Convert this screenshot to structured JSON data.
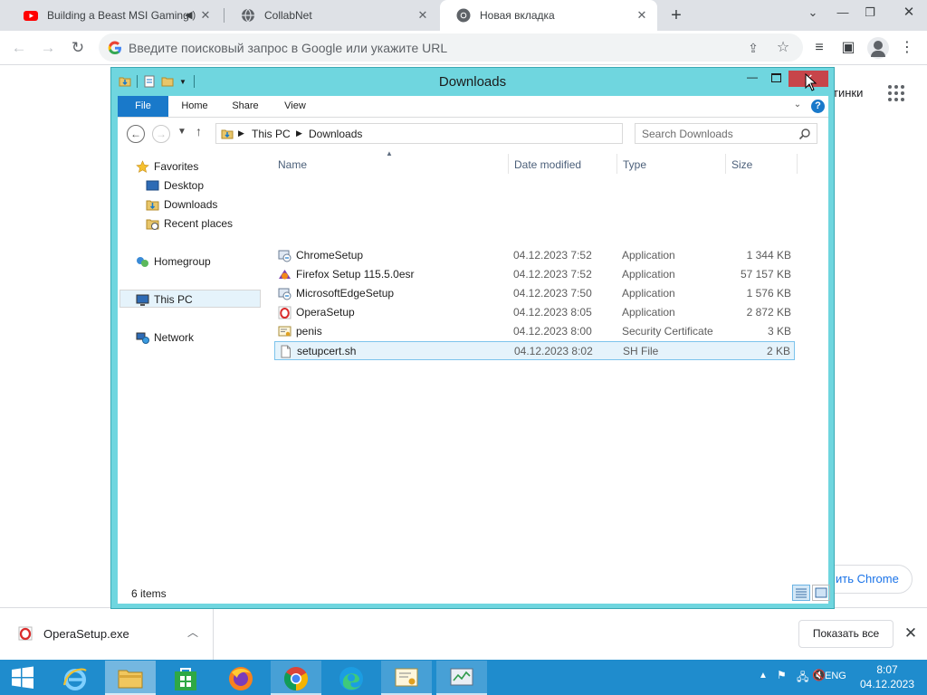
{
  "browser": {
    "tabs": [
      {
        "title": "Building a Beast MSI Gaming",
        "icon": "youtube-icon",
        "audio": true
      },
      {
        "title": "CollabNet",
        "icon": "globe-icon",
        "audio": false
      },
      {
        "title": "Новая вкладка",
        "icon": "chrome-icon",
        "audio": false,
        "active": true
      }
    ],
    "omnibox_placeholder": "Введите поисковый запрос в Google или укажите URL",
    "ntp": {
      "images_link_partial": "тинки",
      "set_chrome_partial": "ить Chrome"
    },
    "download_bar": {
      "file_name": "OperaSetup.exe",
      "show_all": "Показать все"
    }
  },
  "explorer": {
    "title": "Downloads",
    "ribbon_tabs": [
      "File",
      "Home",
      "Share",
      "View"
    ],
    "breadcrumb": [
      "This PC",
      "Downloads"
    ],
    "search_placeholder": "Search Downloads",
    "nav": {
      "favorites": "Favorites",
      "desktop": "Desktop",
      "downloads": "Downloads",
      "recent": "Recent places",
      "homegroup": "Homegroup",
      "this_pc": "This PC",
      "network": "Network"
    },
    "columns": {
      "name": "Name",
      "date": "Date modified",
      "type": "Type",
      "size": "Size"
    },
    "files": [
      {
        "name": "ChromeSetup",
        "date": "04.12.2023 7:52",
        "type": "Application",
        "size": "1 344 KB",
        "icon": "setup-app-icon"
      },
      {
        "name": "Firefox Setup 115.5.0esr",
        "date": "04.12.2023 7:52",
        "type": "Application",
        "size": "57 157 KB",
        "icon": "firefox-setup-icon"
      },
      {
        "name": "MicrosoftEdgeSetup",
        "date": "04.12.2023 7:50",
        "type": "Application",
        "size": "1 576 KB",
        "icon": "setup-app-icon"
      },
      {
        "name": "OperaSetup",
        "date": "04.12.2023 8:05",
        "type": "Application",
        "size": "2 872 KB",
        "icon": "opera-setup-icon"
      },
      {
        "name": "penis",
        "date": "04.12.2023 8:00",
        "type": "Security Certificate",
        "size": "3 KB",
        "icon": "certificate-icon"
      },
      {
        "name": "setupcert.sh",
        "date": "04.12.2023 8:02",
        "type": "SH File",
        "size": "2 KB",
        "icon": "blank-file-icon",
        "selected": true
      }
    ],
    "status": "6 items"
  },
  "taskbar": {
    "language": "ENG",
    "time": "8:07",
    "date": "04.12.2023"
  },
  "colors": {
    "explorer_frame": "#6fd6df",
    "ribbon_file": "#1979ca",
    "close_button": "#c7454a",
    "taskbar": "#1f8ccd",
    "selection": "#e5f3fb"
  }
}
